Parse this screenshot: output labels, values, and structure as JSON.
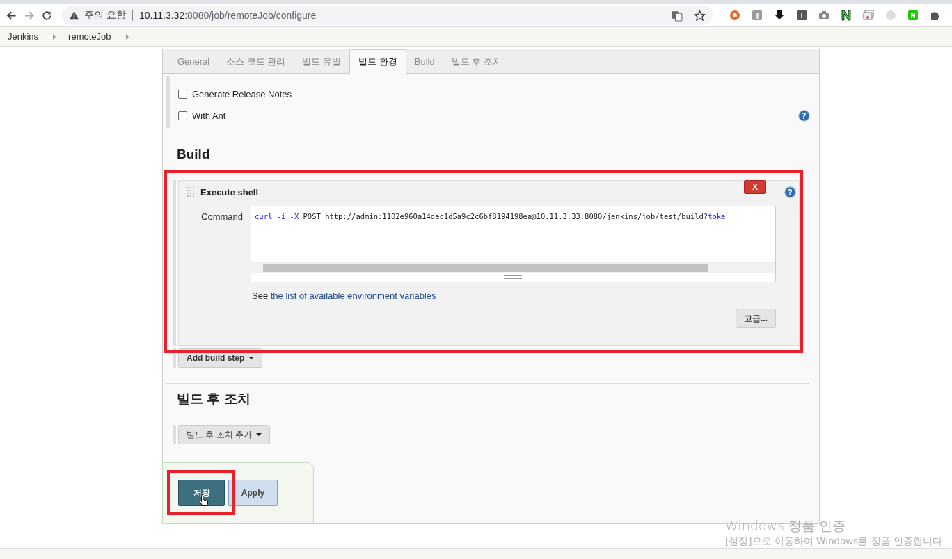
{
  "browser": {
    "security_label": "주의 요함",
    "url_host": "10.11.3.32",
    "url_rest": ":8080/job/remoteJob/configure"
  },
  "breadcrumbs": [
    "Jenkins",
    "remoteJob"
  ],
  "tabs": [
    {
      "label": "General",
      "selected": false
    },
    {
      "label": "소스 코드 관리",
      "selected": false
    },
    {
      "label": "빌드 유발",
      "selected": false
    },
    {
      "label": "빌드 환경",
      "selected": true
    },
    {
      "label": "Build",
      "selected": false
    },
    {
      "label": "빌드 후 조치",
      "selected": false
    }
  ],
  "build_env_options": [
    {
      "label": "Generate Release Notes",
      "checked": false
    },
    {
      "label": "With Ant",
      "checked": false,
      "help": "?"
    }
  ],
  "build": {
    "heading": "Build",
    "step_title": "Execute shell",
    "delete_label": "X",
    "help": "?",
    "command_label": "Command",
    "command_segments": [
      {
        "text": "curl -i -X",
        "kind": "keyword"
      },
      {
        "text": " POST http://admin:1102e960a14dec1d5a9c2c6bf8194198ea@10.11.3.33:8080/jenkins/job/test/build",
        "kind": "plain"
      },
      {
        "text": "?toke",
        "kind": "keyword"
      }
    ],
    "see_text": "See",
    "env_link": "the list of available environment variables",
    "advanced_button": "고급...",
    "add_step_button": "Add build step"
  },
  "post_build": {
    "heading": "빌드 후 조치",
    "add_button": "빌드 후 조치 추가"
  },
  "bottom_buttons": [
    {
      "label": "저장",
      "kind": "primary"
    },
    {
      "label": "Apply",
      "kind": "secondary"
    }
  ],
  "os_notice": {
    "title": "Windows 정품 인증",
    "message": "[설정]으로 이동하여 Windows를 정품 인증합니다"
  }
}
